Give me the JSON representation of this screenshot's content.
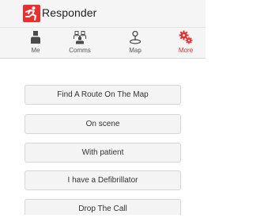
{
  "header": {
    "title": "Responder",
    "logo_icon": "responder-logo-icon",
    "brand_color": "#e8302f"
  },
  "tabs": [
    {
      "label": "Me",
      "icon": "person-icon",
      "active": false
    },
    {
      "label": "Comms",
      "icon": "people-icon",
      "active": false
    },
    {
      "label": "Map",
      "icon": "map-pin-icon",
      "active": false
    },
    {
      "label": "More",
      "icon": "gears-icon",
      "active": true
    }
  ],
  "actions": [
    {
      "label": "Find A Route On The Map"
    },
    {
      "label": "On scene"
    },
    {
      "label": "With patient"
    },
    {
      "label": "I have a Defibrillator"
    },
    {
      "label": "Drop The Call"
    }
  ],
  "colors": {
    "accent": "#e8302f",
    "button_bg": "#f4f4f4",
    "button_border": "#d6d6d6",
    "bar_bg": "#f5f5f5"
  }
}
